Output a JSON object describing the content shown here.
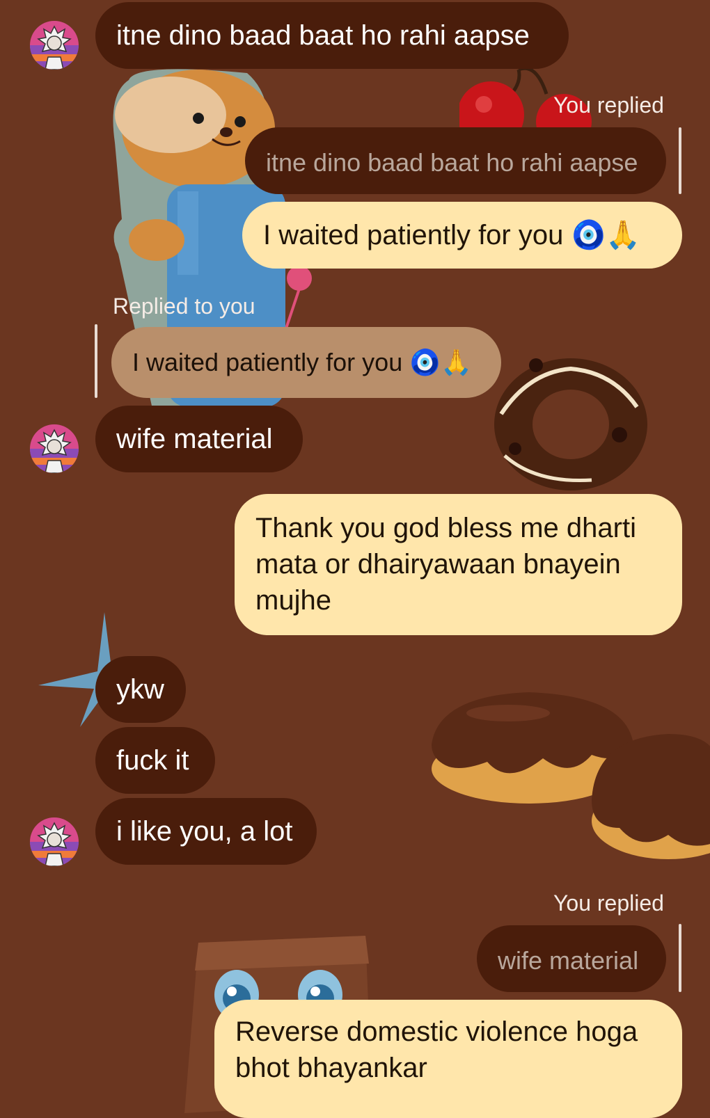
{
  "chat": {
    "messages": [
      {
        "text": "itne dino baad baat ho rahi aapse"
      },
      {
        "reply_label": "You replied",
        "quoted": "itne dino baad baat ho rahi aapse",
        "text": "I waited patiently for you 🧿🙏"
      },
      {
        "reply_label": "Replied to you",
        "quoted": "I waited patiently for you 🧿🙏"
      },
      {
        "text": "wife material"
      },
      {
        "text_line1": "Thank you god bless me dharti",
        "text_line2": "mata or dhairyawaan bnayein",
        "text_line3": "mujhe"
      },
      {
        "text": "ykw"
      },
      {
        "text": "fuck it"
      },
      {
        "text": "i like you, a lot"
      },
      {
        "reply_label": "You replied",
        "quoted": "wife material",
        "text_line1": "Reverse domestic violence hoga",
        "text_line2": "bhot bhayankar"
      }
    ]
  },
  "colors": {
    "background": "#6b3620",
    "incoming_bubble": "#4a1d0b",
    "outgoing_bubble": "#ffe6ab",
    "reply_bubble": "#b98f6b"
  },
  "icons": {
    "avatar": "rick-avatar-icon",
    "evil_eye": "nazar-amulet-icon",
    "pray": "folded-hands-icon"
  }
}
